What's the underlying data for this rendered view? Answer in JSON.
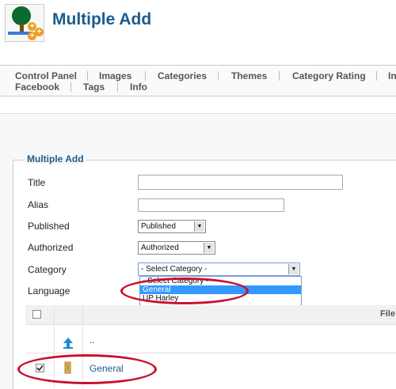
{
  "header": {
    "title": "Multiple Add",
    "logo": "gallery-add-icon"
  },
  "toolbar": {
    "row1": [
      "Control Panel",
      "Images",
      "Categories",
      "Themes",
      "Category Rating",
      "In"
    ],
    "row2": [
      "Facebook",
      "Tags",
      "Info"
    ]
  },
  "form": {
    "legend": "Multiple Add",
    "title_label": "Title",
    "title_value": "",
    "alias_label": "Alias",
    "alias_value": "",
    "published_label": "Published",
    "published_value": "Published",
    "authorized_label": "Authorized",
    "authorized_value": "Authorized",
    "category_label": "Category",
    "category_value": "- Select Category -",
    "category_options": [
      "- Select Category -",
      "General",
      "UP Harley"
    ],
    "category_highlighted": "General",
    "language_label": "Language"
  },
  "table": {
    "header_col": "File",
    "rows": [
      {
        "icon": "folder-up-icon",
        "name": "..",
        "checked": false
      },
      {
        "icon": "folder-icon",
        "name": "General",
        "checked": true
      }
    ]
  },
  "colors": {
    "title": "#1b5b8c",
    "annotation": "#c8102e",
    "highlight": "#3399ff"
  }
}
